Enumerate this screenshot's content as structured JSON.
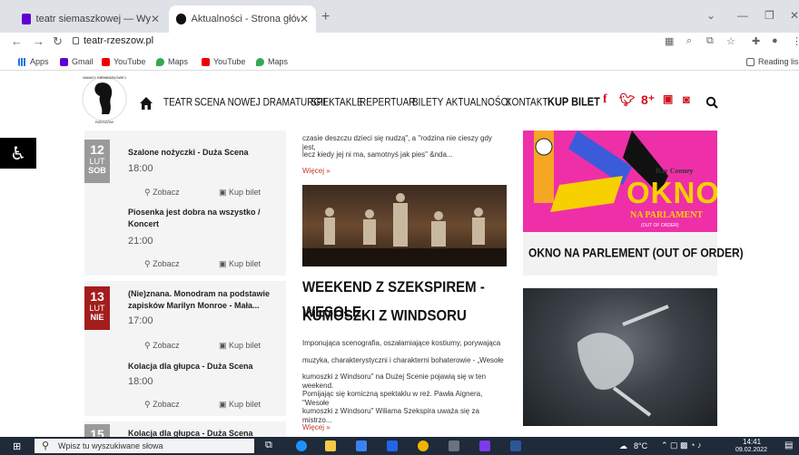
{
  "tabs": [
    {
      "title": "teatr siemaszkowej — Wyniki wy"
    },
    {
      "title": "Aktualności - Strona główna"
    }
  ],
  "url": "teatr-rzeszow.pl",
  "bookmarks": [
    "Apps",
    "Gmail",
    "YouTube",
    "Maps",
    "YouTube",
    "Maps"
  ],
  "reading_list": "Reading lis",
  "logo_text": "WANDY SIEMASZKOWEJ TEATR IM. RZESZÓW",
  "nav": [
    "TEATR",
    "SCENA NOWEJ DRAMATURGII",
    "SPEKTAKLE",
    "REPERTUAR",
    "BILETY",
    "AKTUALNOŚCI",
    "KONTAKT",
    "KUP BILET"
  ],
  "events": {
    "links": {
      "see": "Zobacz",
      "buy": "Kup bilet"
    },
    "day12": {
      "day": "12",
      "month": "LUT",
      "weekday": "SOB"
    },
    "day13": {
      "day": "13",
      "month": "LUT",
      "weekday": "NIE"
    },
    "items": [
      {
        "title": "Szalone nożyczki - Duża Scena",
        "time": "18:00"
      },
      {
        "title": "Piosenka jest dobra na wszystko / Koncert",
        "time": "21:00"
      },
      {
        "title": "(Nie)znana. Monodram na podstawie zapisków Marilyn Monroe - Mała...",
        "time": "17:00"
      },
      {
        "title": "Kolacja dla głupca - Duża Scena",
        "time": "18:00"
      },
      {
        "title": "Kolacja dla głupca - Duża Scena"
      }
    ],
    "peek_day": "15"
  },
  "news": {
    "top_text1": "czasie deszczu dzieci się nudzą\", a \"rodzina nie cieszy gdy jest,",
    "top_text2": "lecz kiedy jej ni ma, samotnyś jak pies\" &nda...",
    "more": "Więcej »",
    "headline1": "WEEKEND Z SZEKSPIREM - WESOŁE",
    "headline2": "KUMOSZKI Z WINDSORU",
    "body": [
      "Imponująca scenografia, oszałamiające kostiumy, porywająca",
      "muzyka, charakterystyczni i charakterni bohaterowie - „Wesołe",
      "kumoszki z Windsoru\" na Dużej Scenie pojawią się w ten weekend.",
      "  Pomijając się komiczną spektaklu w reż. Pawła Aignera, \"Wesołe",
      "kumoszki z Windsoru\" Wiliama Szekspira uważa się za mistrzo..."
    ]
  },
  "poster": {
    "author": "Ray Cooney",
    "title_big": "OKNO",
    "title_small": "NA PARLAMENT",
    "sub": "(OUT OF ORDER)",
    "caption": "OKNO NA PARLEMENT (OUT OF ORDER)"
  },
  "taskbar": {
    "search": "Wpisz tu wyszukiwane słowa",
    "temp": "8°C",
    "time": "14:41",
    "date": "09.02.2022"
  },
  "colors": {
    "red": "#a31d1d",
    "grey_box": "#9a9a9a",
    "pink": "#ee2fa8",
    "brand_red": "#d0121f"
  }
}
